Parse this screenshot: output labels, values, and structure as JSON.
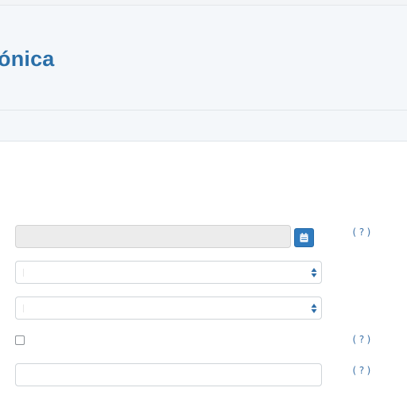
{
  "header": {
    "title": "ónica"
  },
  "form": {
    "date_field": {
      "value": ""
    },
    "select_1": {
      "value": ""
    },
    "select_2": {
      "value": ""
    },
    "checkbox": {
      "checked": false
    },
    "text_field": {
      "value": ""
    },
    "help_label": "(?)"
  },
  "icons": {
    "date_button": "calendar-icon",
    "select_caret": "up-down-caret-icon"
  },
  "colors": {
    "accent": "#2f7bbf",
    "title": "#2a6fa8",
    "header_bg": "#f4f7fa",
    "disabled_field": "#ececec"
  }
}
